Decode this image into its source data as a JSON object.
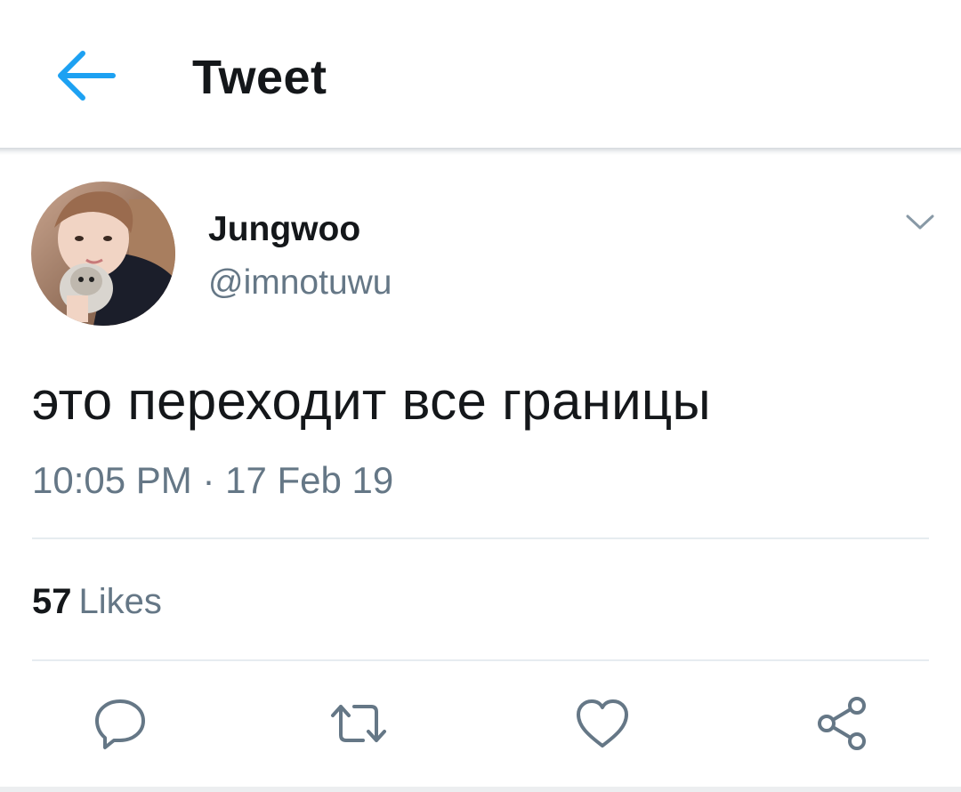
{
  "header": {
    "title": "Tweet",
    "back_icon": "arrow-left-icon",
    "accent_color": "#1da1f2"
  },
  "tweet": {
    "author": {
      "display_name": "Jungwoo",
      "handle": "@imnotuwu",
      "avatar_icon": "user-avatar"
    },
    "menu_icon": "chevron-down-icon",
    "text": "это переходит все границы",
    "time": "10:05 PM",
    "separator": "·",
    "date": "17 Feb 19",
    "likes": {
      "count": "57",
      "label": "Likes"
    },
    "actions": [
      {
        "icon": "reply-icon"
      },
      {
        "icon": "retweet-icon"
      },
      {
        "icon": "heart-icon"
      },
      {
        "icon": "share-icon"
      }
    ]
  },
  "colors": {
    "text_primary": "#14171a",
    "text_secondary": "#657786",
    "divider": "#e6ecf0",
    "icon_gray": "#657786"
  }
}
